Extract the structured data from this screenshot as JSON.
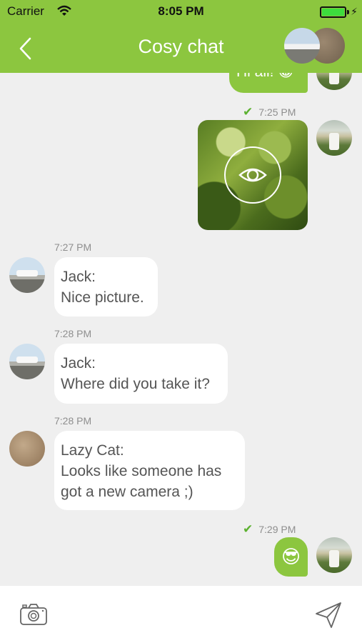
{
  "status_bar": {
    "carrier": "Carrier",
    "time": "8:05 PM"
  },
  "header": {
    "title": "Cosy chat"
  },
  "messages": [
    {
      "direction": "out",
      "text": "Hi all! 😀"
    },
    {
      "direction": "out",
      "time": "7:25 PM",
      "type": "image"
    },
    {
      "direction": "in",
      "time": "7:27 PM",
      "sender": "Jack:",
      "text": "Nice picture."
    },
    {
      "direction": "in",
      "time": "7:28 PM",
      "sender": "Jack:",
      "text": "Where did you take it?"
    },
    {
      "direction": "in",
      "time": "7:28 PM",
      "sender": "Lazy Cat:",
      "text_lines": [
        "Looks like someone has",
        "got a new camera ;)"
      ]
    },
    {
      "direction": "out",
      "time": "7:29 PM",
      "text": "😎"
    }
  ],
  "composer": {
    "icons": [
      "camera-icon",
      "send-icon"
    ]
  },
  "colors": {
    "accent": "#8cc63f",
    "background": "#efefef",
    "check": "#5cb130"
  }
}
